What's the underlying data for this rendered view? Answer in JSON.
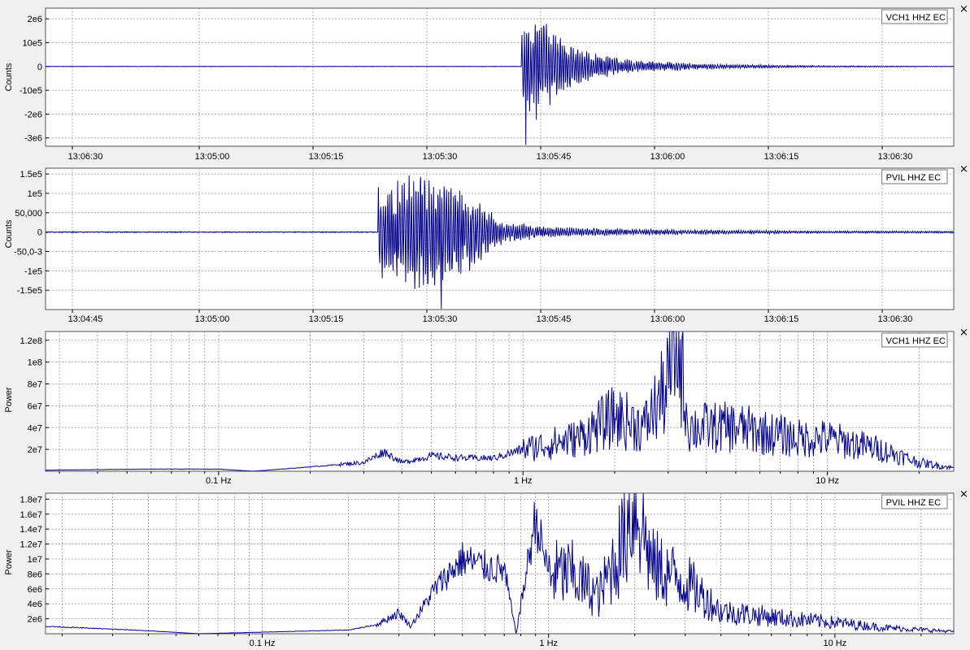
{
  "colors": {
    "background": "#f0f0f0",
    "plot_bg": "#ffffff",
    "grid": "#999999",
    "trace": "#00008b"
  },
  "icons": {
    "close": "close-icon"
  },
  "close_glyph": "×",
  "chart_data": [
    {
      "type": "line",
      "legend": "VCH1 HHZ EC",
      "legend_position": "top-right",
      "ylabel": "Counts",
      "xlabel": "",
      "grid": true,
      "x_ticks": [
        "13:06:30",
        "13:05:00",
        "13:05:15",
        "13:05:30",
        "13:05:45",
        "13:06:00",
        "13:06:15",
        "13:06:30"
      ],
      "y_ticks": [
        {
          "label": "2e6",
          "value": 2000000
        },
        {
          "label": "10e5",
          "value": 1000000
        },
        {
          "label": "0",
          "value": 0
        },
        {
          "label": "-10e5",
          "value": -1000000
        },
        {
          "label": "-2e6",
          "value": -2000000
        },
        {
          "label": "-3e6",
          "value": -3000000
        }
      ],
      "ylim": [
        -3350000,
        2450000
      ],
      "x_range_seconds": [
        -35,
        85
      ],
      "envelope": {
        "onset_s": 27.9,
        "points": [
          [
            0,
            1500000
          ],
          [
            2,
            2300000
          ],
          [
            4,
            1600000
          ],
          [
            7,
            900000
          ],
          [
            10,
            550000
          ],
          [
            15,
            280000
          ],
          [
            25,
            100000
          ],
          [
            40,
            40000
          ],
          [
            57,
            10000
          ]
        ],
        "spike": {
          "t": 0.55,
          "value": -3300000
        },
        "base_noise": 6000
      }
    },
    {
      "type": "line",
      "legend": "PVIL HHZ EC",
      "legend_position": "top-right",
      "ylabel": "Counts",
      "xlabel": "",
      "grid": true,
      "x_ticks": [
        "13:04:45",
        "13:05:00",
        "13:05:15",
        "13:05:30",
        "13:05:45",
        "13:06:00",
        "13:06:15",
        "13:06:30"
      ],
      "y_ticks": [
        {
          "label": "1.5e5",
          "value": 150000
        },
        {
          "label": "1e5",
          "value": 100000
        },
        {
          "label": "50,000",
          "value": 50000
        },
        {
          "label": "0",
          "value": 0
        },
        {
          "label": "-50,0-3",
          "value": -50000
        },
        {
          "label": "-1e5",
          "value": -100000
        },
        {
          "label": "-1.5e5",
          "value": -150000
        }
      ],
      "ylim": [
        -200000,
        165000
      ],
      "x_range_seconds": [
        -20,
        100
      ],
      "envelope": {
        "onset_s": 23.9,
        "points": [
          [
            0,
            120000
          ],
          [
            3,
            140000
          ],
          [
            6,
            165000
          ],
          [
            9,
            145000
          ],
          [
            11,
            120000
          ],
          [
            14,
            70000
          ],
          [
            17,
            30000
          ],
          [
            22,
            14000
          ],
          [
            35,
            8000
          ],
          [
            60,
            3000
          ]
        ],
        "spike": {
          "t": 8.4,
          "value": -198000
        },
        "base_noise": 900
      }
    },
    {
      "type": "line",
      "legend": "VCH1 HHZ EC",
      "legend_position": "top-right",
      "ylabel": "Power",
      "xlabel": "",
      "grid": true,
      "x_scale": "log",
      "x_ticks": [
        {
          "label": "0.1 Hz",
          "value": 0.1
        },
        {
          "label": "1 Hz",
          "value": 1
        },
        {
          "label": "10 Hz",
          "value": 10
        }
      ],
      "xlim": [
        0.027,
        26
      ],
      "y_ticks": [
        {
          "label": "1.2e8",
          "value": 120000000
        },
        {
          "label": "1e8",
          "value": 100000000
        },
        {
          "label": "8e7",
          "value": 80000000
        },
        {
          "label": "6e7",
          "value": 60000000
        },
        {
          "label": "4e7",
          "value": 40000000
        },
        {
          "label": "2e7",
          "value": 20000000
        }
      ],
      "ylim": [
        0,
        128000000
      ],
      "spectrum": [
        {
          "f": 0.027,
          "p": 1000000
        },
        {
          "f": 0.06,
          "p": 2000000
        },
        {
          "f": 0.1,
          "p": 2000000
        },
        {
          "f": 0.13,
          "p": 0
        },
        {
          "f": 0.2,
          "p": 4000000
        },
        {
          "f": 0.3,
          "p": 8000000
        },
        {
          "f": 0.35,
          "p": 18000000
        },
        {
          "f": 0.4,
          "p": 8000000
        },
        {
          "f": 0.5,
          "p": 14000000
        },
        {
          "f": 0.65,
          "p": 12000000
        },
        {
          "f": 0.8,
          "p": 12000000
        },
        {
          "f": 1.0,
          "p": 20000000
        },
        {
          "f": 1.5,
          "p": 30000000
        },
        {
          "f": 2.0,
          "p": 50000000
        },
        {
          "f": 2.5,
          "p": 40000000
        },
        {
          "f": 3.0,
          "p": 80000000
        },
        {
          "f": 3.2,
          "p": 128000000
        },
        {
          "f": 3.5,
          "p": 40000000
        },
        {
          "f": 5.0,
          "p": 40000000
        },
        {
          "f": 8.0,
          "p": 30000000
        },
        {
          "f": 10.0,
          "p": 30000000
        },
        {
          "f": 15.0,
          "p": 20000000
        },
        {
          "f": 20.0,
          "p": 8000000
        },
        {
          "f": 26.0,
          "p": 3000000
        }
      ]
    },
    {
      "type": "line",
      "legend": "PVIL HHZ EC",
      "legend_position": "top-right",
      "ylabel": "Power",
      "xlabel": "",
      "grid": true,
      "x_scale": "log",
      "x_ticks": [
        {
          "label": "0.1 Hz",
          "value": 0.1
        },
        {
          "label": "1 Hz",
          "value": 1
        },
        {
          "label": "10 Hz",
          "value": 10
        }
      ],
      "xlim": [
        0.0175,
        26
      ],
      "y_ticks": [
        {
          "label": "1.8e7",
          "value": 18000000
        },
        {
          "label": "1.6e7",
          "value": 16000000
        },
        {
          "label": "1.4e7",
          "value": 14000000
        },
        {
          "label": "1.2e7",
          "value": 12000000
        },
        {
          "label": "1e7",
          "value": 10000000
        },
        {
          "label": "8e6",
          "value": 8000000
        },
        {
          "label": "6e6",
          "value": 6000000
        },
        {
          "label": "4e6",
          "value": 4000000
        },
        {
          "label": "2e6",
          "value": 2000000
        }
      ],
      "ylim": [
        0,
        18800000
      ],
      "spectrum": [
        {
          "f": 0.0175,
          "p": 1000000
        },
        {
          "f": 0.04,
          "p": 400000
        },
        {
          "f": 0.06,
          "p": 0
        },
        {
          "f": 0.2,
          "p": 500000
        },
        {
          "f": 0.25,
          "p": 1200000
        },
        {
          "f": 0.3,
          "p": 2800000
        },
        {
          "f": 0.33,
          "p": 1000000
        },
        {
          "f": 0.4,
          "p": 6000000
        },
        {
          "f": 0.5,
          "p": 10000000
        },
        {
          "f": 0.6,
          "p": 9000000
        },
        {
          "f": 0.7,
          "p": 8500000
        },
        {
          "f": 0.77,
          "p": 0
        },
        {
          "f": 0.9,
          "p": 15500000
        },
        {
          "f": 1.0,
          "p": 8000000
        },
        {
          "f": 1.2,
          "p": 8000000
        },
        {
          "f": 1.5,
          "p": 5000000
        },
        {
          "f": 1.8,
          "p": 12000000
        },
        {
          "f": 2.0,
          "p": 18800000
        },
        {
          "f": 2.3,
          "p": 9000000
        },
        {
          "f": 3.0,
          "p": 7000000
        },
        {
          "f": 4.0,
          "p": 3000000
        },
        {
          "f": 7.0,
          "p": 2000000
        },
        {
          "f": 10.0,
          "p": 1500000
        },
        {
          "f": 15.0,
          "p": 800000
        },
        {
          "f": 26.0,
          "p": 300000
        }
      ]
    }
  ]
}
